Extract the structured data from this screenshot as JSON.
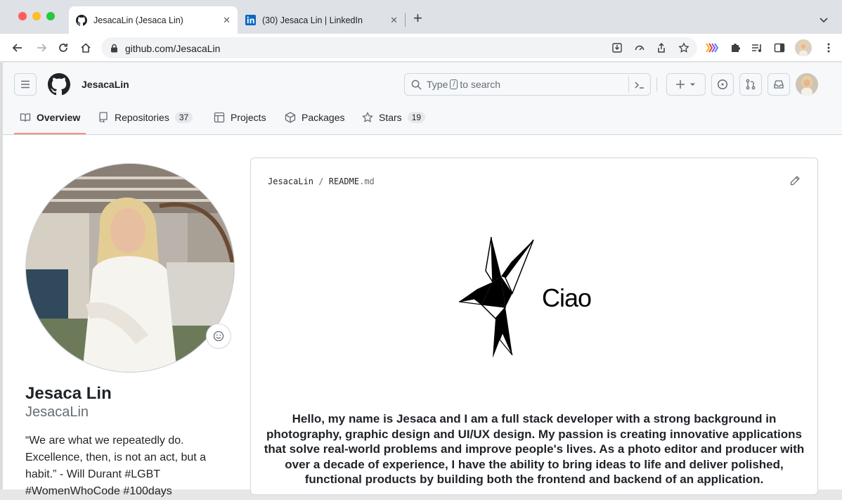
{
  "browser": {
    "tabs": [
      {
        "title": "JesacaLin (Jesaca Lin)"
      },
      {
        "title": "(30) Jesaca Lin | LinkedIn"
      }
    ],
    "url_host": "github.com/",
    "url_path": "JesacaLin"
  },
  "github": {
    "username": "JesacaLin",
    "search_prefix": "Type",
    "search_key": "/",
    "search_suffix": "to search",
    "nav": [
      {
        "label": "Overview",
        "icon": "book-icon"
      },
      {
        "label": "Repositories",
        "icon": "repo-icon",
        "count": "37"
      },
      {
        "label": "Projects",
        "icon": "table-icon"
      },
      {
        "label": "Packages",
        "icon": "package-icon"
      },
      {
        "label": "Stars",
        "icon": "star-icon",
        "count": "19"
      }
    ]
  },
  "profile": {
    "name": "Jesaca Lin",
    "login": "JesacaLin",
    "bio": "“We are what we repeatedly do. Excellence, then, is not an act, but a habit.” - Will Durant #LGBT #WomenWhoCode #100days"
  },
  "readme": {
    "owner": "JesacaLin",
    "sep": "/",
    "file": "README",
    "ext": ".md",
    "greeting": "Ciao",
    "intro": "Hello, my name is Jesaca and I am a full stack developer with a strong background in photography, graphic design and UI/UX design. My passion is creating innovative applications that solve real-world problems and improve people's lives. As a photo editor and producer with over a decade of experience, I have the ability to bring ideas to life and deliver polished, functional products by building both the frontend and backend of an application."
  },
  "colors": {
    "accent_underline": "#fd8c73",
    "linkedin_blue": "#0a66c2"
  }
}
